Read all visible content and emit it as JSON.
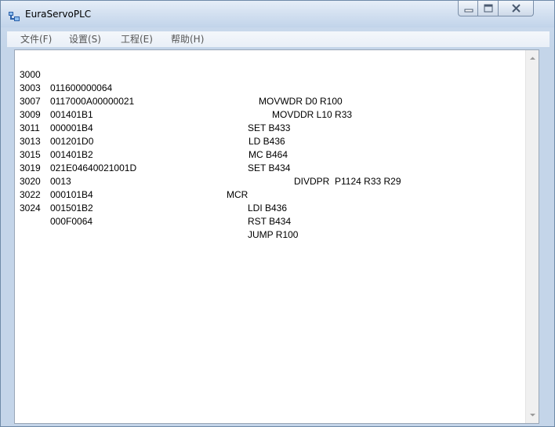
{
  "window": {
    "title": "EuraServoPLC",
    "icons": {
      "app": "plc-app-icon",
      "minimize": "minimize-icon",
      "maximize": "maximize-icon",
      "close": "close-icon"
    }
  },
  "menu": {
    "items": [
      {
        "label": "文件(F)"
      },
      {
        "label": "设置(S)"
      },
      {
        "label": "工程(E)"
      },
      {
        "label": "帮助(H)"
      }
    ]
  },
  "editor": {
    "lines": [
      {
        "addr": "3000",
        "hex": "011600000064",
        "instr": "MOVWDR D0 R100"
      },
      {
        "addr": "3003",
        "hex": "0117000A00000021",
        "instr": "MOVDDR L10 R33"
      },
      {
        "addr": "3007",
        "hex": "001401B1",
        "instr": "SET B433"
      },
      {
        "addr": "3009",
        "hex": "000001B4",
        "instr": "LD B436"
      },
      {
        "addr": "3011",
        "hex": "001201D0",
        "instr": "MC B464"
      },
      {
        "addr": "3013",
        "hex": "001401B2",
        "instr": "SET B434"
      },
      {
        "addr": "3015",
        "hex": "021E04640021001D",
        "instr": "DIVDPR  P1124 R33 R29"
      },
      {
        "addr": "3019",
        "hex": "0013",
        "instr": "MCR"
      },
      {
        "addr": "3020",
        "hex": "000101B4",
        "instr": "LDI B436"
      },
      {
        "addr": "3022",
        "hex": "001501B2",
        "instr": "RST B434"
      },
      {
        "addr": "3024",
        "hex": "000F0064",
        "instr": "JUMP R100"
      }
    ],
    "scroll_icons": {
      "up": "scroll-up-arrow-icon",
      "down": "scroll-down-arrow-icon"
    }
  },
  "colors": {
    "titlebar": "#d4e1f1",
    "editor_background": "#ffffff",
    "text": "#000000"
  }
}
